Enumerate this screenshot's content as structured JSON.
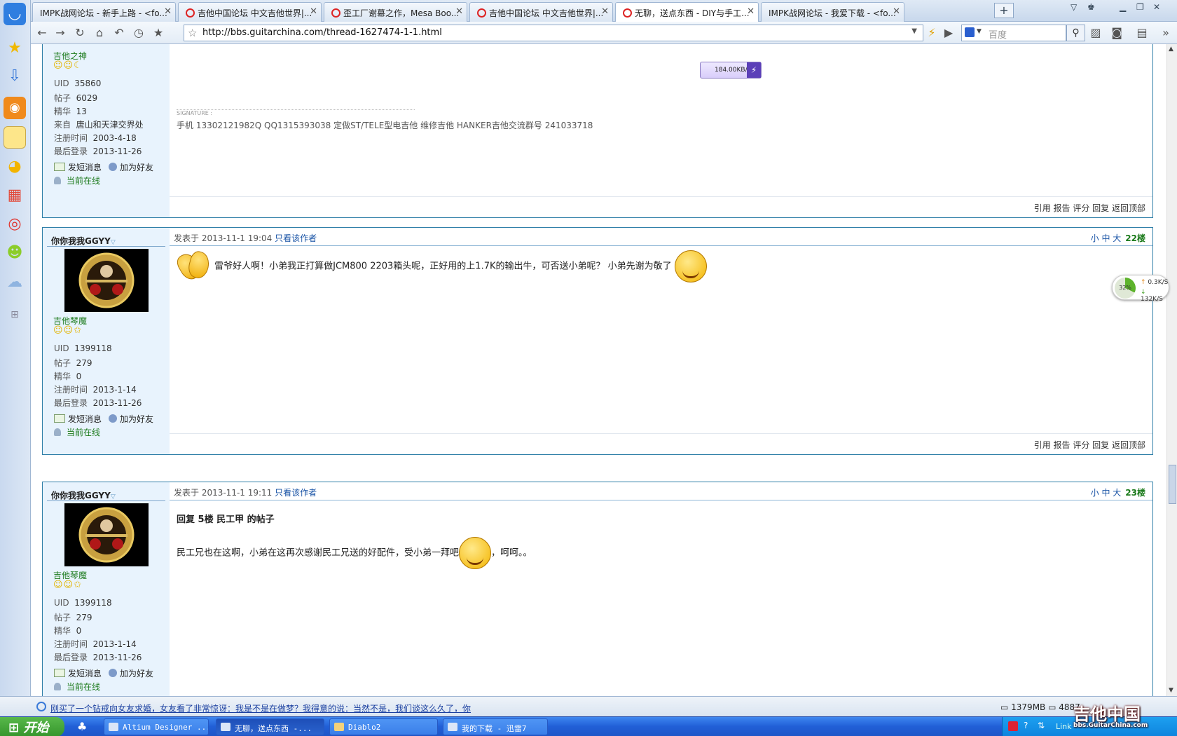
{
  "browser": {
    "tabs": [
      {
        "label": "IMPK战网论坛 - 新手上路 - <fo..."
      },
      {
        "label": "吉他中国论坛 中文吉他世界|..."
      },
      {
        "label": "歪工厂谢幕之作，Mesa Boo..."
      },
      {
        "label": "吉他中国论坛 中文吉他世界|..."
      },
      {
        "label": "无聊，送点东西 - DIY与手工..."
      },
      {
        "label": "IMPK战网论坛 - 我爱下载 - <fo..."
      }
    ],
    "address": "http://bbs.guitarchina.com/thread-1627474-1-1.html",
    "search_placeholder": "百度"
  },
  "posts": [
    {
      "rank": "吉他之神",
      "uid": "35860",
      "posts": "6029",
      "essence": "13",
      "from": "唐山和天津交界处",
      "registered": "2003-4-18",
      "last_login": "2013-11-26",
      "speed": "184.00KB/s",
      "signature_label": "SIGNATURE :",
      "signature": "手机 13302121982Q    QQ1315393038   定做ST/TELE型电吉他  维修吉他 HANKER吉他交流群号 241033718"
    },
    {
      "username": "你你我我GGYY",
      "rank": "吉他琴魔",
      "uid": "1399118",
      "posts": "279",
      "essence": "0",
      "registered": "2013-1-14",
      "last_login": "2013-11-26",
      "time": "发表于 2013-11-1 19:04",
      "author_only": "只看该作者",
      "floor": "22楼",
      "text": "雷爷好人啊！小弟我正打算做JCM800 2203箱头呢，正好用的上1.7K的输出牛，可否送小弟呢？ 小弟先谢为敬了"
    },
    {
      "username": "你你我我GGYY",
      "rank": "吉他琴魔",
      "uid": "1399118",
      "posts": "279",
      "essence": "0",
      "registered": "2013-1-14",
      "last_login": "2013-11-26",
      "time": "发表于 2013-11-1 19:11",
      "author_only": "只看该作者",
      "floor": "23楼",
      "reply_title": "回复 5楼 民工甲 的帖子",
      "text": "民工兄也在这啊，小弟在这再次感谢民工兄送的好配件，受小弟一拜吧",
      "text_tail": "，呵呵。。"
    }
  ],
  "labels": {
    "uid": "UID",
    "posts": "帖子",
    "essence": "精华",
    "from": "来自",
    "registered": "注册时间",
    "last_login": "最后登录",
    "send_msg": "发短消息",
    "add_friend": "加为好友",
    "online": "当前在线",
    "font_sizes": "小 中 大",
    "footer_actions": "引用 报告 评分 回复 返回顶部"
  },
  "widget": {
    "percent": "32%",
    "up": "0.3K/S",
    "down": "132K/S"
  },
  "status": {
    "news": "刚买了一个钻戒向女友求婚，女友看了非常惊讶：我是不是在做梦？我得意的说：当然不是，我们谈这么久了，你",
    "memory": "1379MB",
    "count": "4887"
  },
  "taskbar": {
    "start": "开始",
    "items": [
      {
        "label": "Altium Designer ..."
      },
      {
        "label": "无聊，送点东西 -..."
      },
      {
        "label": "Diablo2"
      },
      {
        "label": "我的下载 - 迅雷7"
      }
    ],
    "tray_text": "Link"
  },
  "logo": {
    "main": "吉他中国",
    "sub": "bbs.GuitarChina.com"
  }
}
